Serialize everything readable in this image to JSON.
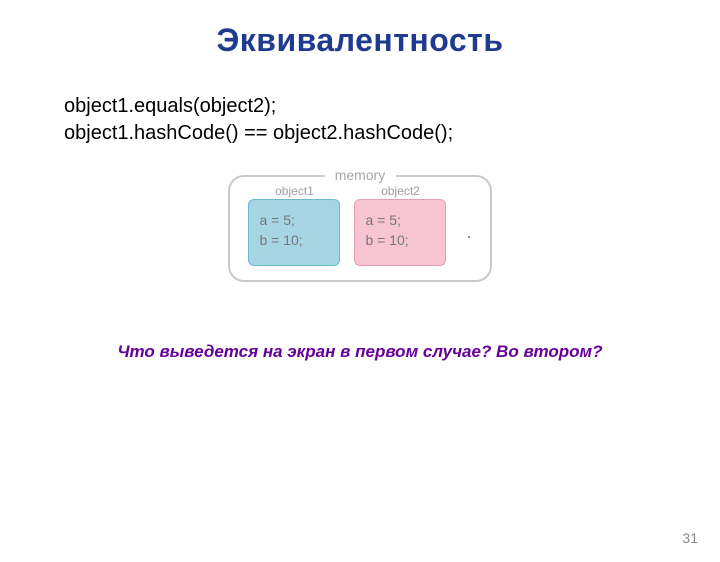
{
  "title": "Эквивалентность",
  "code": {
    "line1": "object1.equals(object2);",
    "line2": "object1.hashCode() == object2.hashCode();"
  },
  "diagram": {
    "memory_label": "memory",
    "object1": {
      "label": "object1",
      "line1": "a = 5;",
      "line2": "b = 10;"
    },
    "object2": {
      "label": "object2",
      "line1": "a = 5;",
      "line2": "b = 10;"
    },
    "dot": "."
  },
  "question": "Что выведется на экран в первом случае? Во втором?",
  "page_number": "31"
}
